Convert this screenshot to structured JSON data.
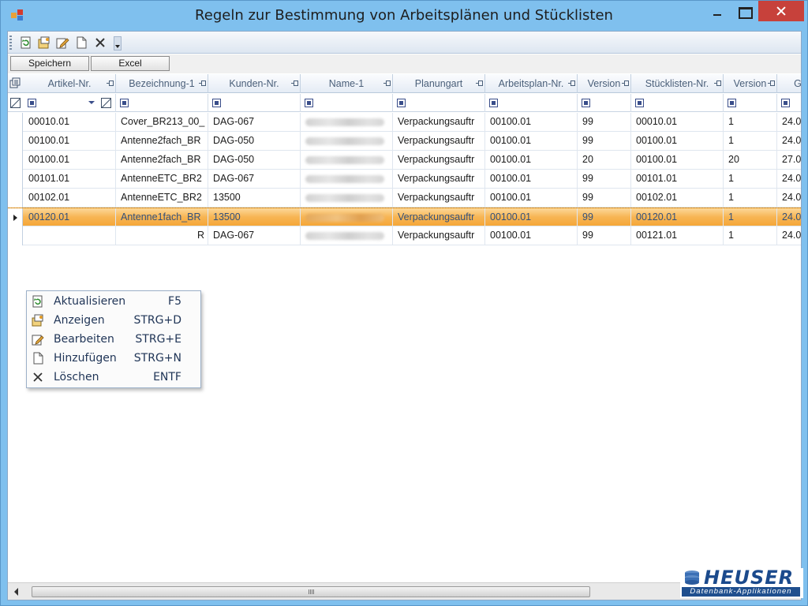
{
  "window": {
    "title": "Regeln zur Bestimmung von Arbeitsplänen und Stücklisten"
  },
  "toolbar": {
    "items": [
      "refresh-icon",
      "show-icon",
      "edit-icon",
      "new-icon",
      "delete-icon"
    ]
  },
  "buttons": {
    "save_label": "Speichern",
    "excel_label": "Excel"
  },
  "grid": {
    "columns": [
      "Artikel-Nr.",
      "Bezeichnung-1",
      "Kunden-Nr.",
      "Name-1",
      "Planungart",
      "Arbeitsplan-Nr.",
      "Version",
      "Stücklisten-Nr.",
      "Version",
      "Ge"
    ],
    "rows": [
      [
        "00010.01",
        "Cover_BR213_00_",
        "DAG-067",
        "",
        "Verpackungsauftr",
        "00100.01",
        "99",
        "00010.01",
        "1",
        "24.0"
      ],
      [
        "00100.01",
        "Antenne2fach_BR",
        "DAG-050",
        "",
        "Verpackungsauftr",
        "00100.01",
        "99",
        "00100.01",
        "1",
        "24.0"
      ],
      [
        "00100.01",
        "Antenne2fach_BR",
        "DAG-050",
        "",
        "Verpackungsauftr",
        "00100.01",
        "20",
        "00100.01",
        "20",
        "27.0"
      ],
      [
        "00101.01",
        "AntenneETC_BR2",
        "DAG-067",
        "",
        "Verpackungsauftr",
        "00100.01",
        "99",
        "00101.01",
        "1",
        "24.0"
      ],
      [
        "00102.01",
        "AntenneETC_BR2",
        "13500",
        "",
        "Verpackungsauftr",
        "00100.01",
        "99",
        "00102.01",
        "1",
        "24.0"
      ],
      [
        "00120.01",
        "Antenne1fach_BR",
        "13500",
        "",
        "Verpackungsauftr",
        "00100.01",
        "99",
        "00120.01",
        "1",
        "24.0"
      ],
      [
        "",
        "R",
        "DAG-067",
        "",
        "Verpackungsauftr",
        "00100.01",
        "99",
        "00121.01",
        "1",
        "24.0"
      ]
    ],
    "selected_row": 5
  },
  "context_menu": {
    "items": [
      {
        "label": "Aktualisieren",
        "shortcut": "F5",
        "icon": "refresh-icon"
      },
      {
        "label": "Anzeigen",
        "shortcut": "STRG+D",
        "icon": "show-icon"
      },
      {
        "label": "Bearbeiten",
        "shortcut": "STRG+E",
        "icon": "edit-icon"
      },
      {
        "label": "Hinzufügen",
        "shortcut": "STRG+N",
        "icon": "new-icon"
      },
      {
        "label": "Löschen",
        "shortcut": "ENTF",
        "icon": "delete-icon"
      }
    ]
  },
  "logo": {
    "name": "HEUSER",
    "tagline": "Datenbank-Applikationen"
  },
  "colors": {
    "titlebar": "#7fc0ee",
    "selection": "#f7b554",
    "close_button": "#c7413b",
    "logo_blue": "#1f4f8e"
  }
}
